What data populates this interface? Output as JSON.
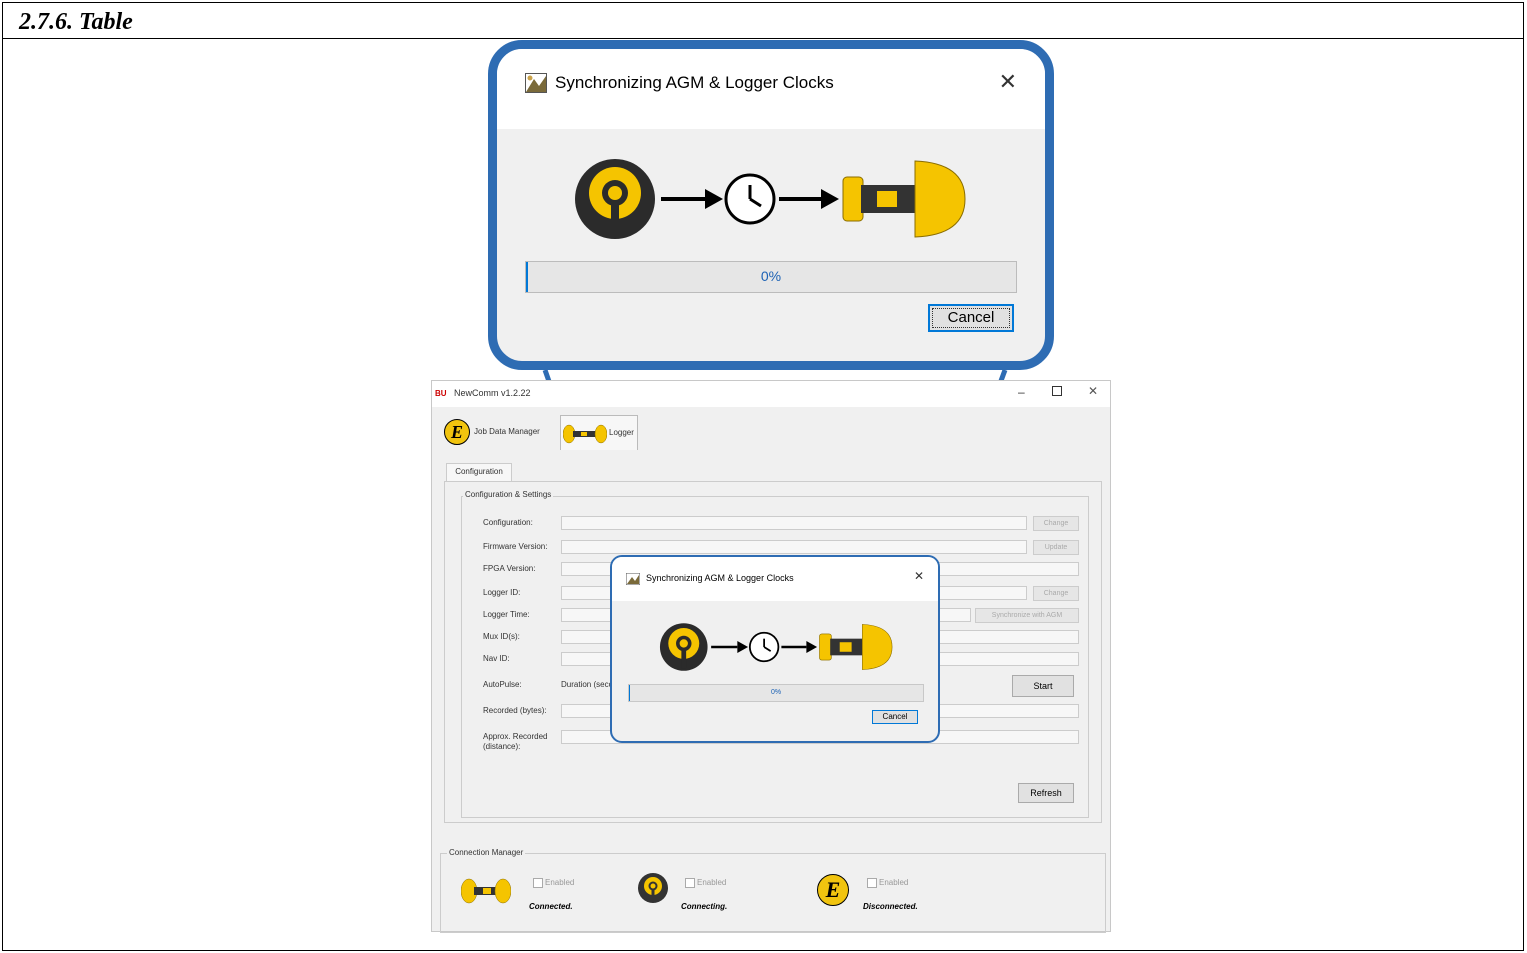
{
  "section_heading": "2.7.6. Table",
  "dialog": {
    "title": "Synchronizing AGM & Logger Clocks",
    "close_glyph": "✕",
    "progress_percent": 0,
    "progress_text": "0%",
    "cancel_label": "Cancel"
  },
  "app": {
    "logo_text": "BU",
    "title": "NewComm v1.2.22",
    "tabs": [
      {
        "label": "Job Data Manager",
        "icon": "e-badge-icon"
      },
      {
        "label": "Logger",
        "icon": "logger-icon"
      }
    ],
    "sub_tab": "Configuration",
    "group_title": "Configuration & Settings",
    "rows": [
      {
        "label": "Configuration:",
        "button": "Change"
      },
      {
        "label": "Firmware Version:",
        "button": "Update"
      },
      {
        "label": "FPGA Version:"
      },
      {
        "label": "Logger ID:",
        "button": "Change"
      },
      {
        "label": "Logger Time:",
        "button": "Synchronize with AGM"
      },
      {
        "label": "Mux ID(s):"
      },
      {
        "label": "Nav ID:"
      },
      {
        "label": "AutoPulse:",
        "extra": "Duration (seconds)"
      },
      {
        "label": "Recorded (bytes):"
      },
      {
        "label": "Approx. Recorded (distance):"
      }
    ],
    "start_label": "Start",
    "refresh_label": "Refresh",
    "connection_manager": {
      "title": "Connection Manager",
      "items": [
        {
          "device": "logger-icon",
          "checkbox_label": "Enabled",
          "status": "Connected."
        },
        {
          "device": "agm-icon",
          "checkbox_label": "Enabled",
          "status": "Connecting."
        },
        {
          "device": "e-badge-icon",
          "checkbox_label": "Enabled",
          "status": "Disconnected."
        }
      ]
    },
    "badge_letter": "E"
  },
  "colors": {
    "callout_border": "#2e6cb3",
    "accent_yellow": "#f5c400",
    "progress_fill": "#0078d7"
  }
}
